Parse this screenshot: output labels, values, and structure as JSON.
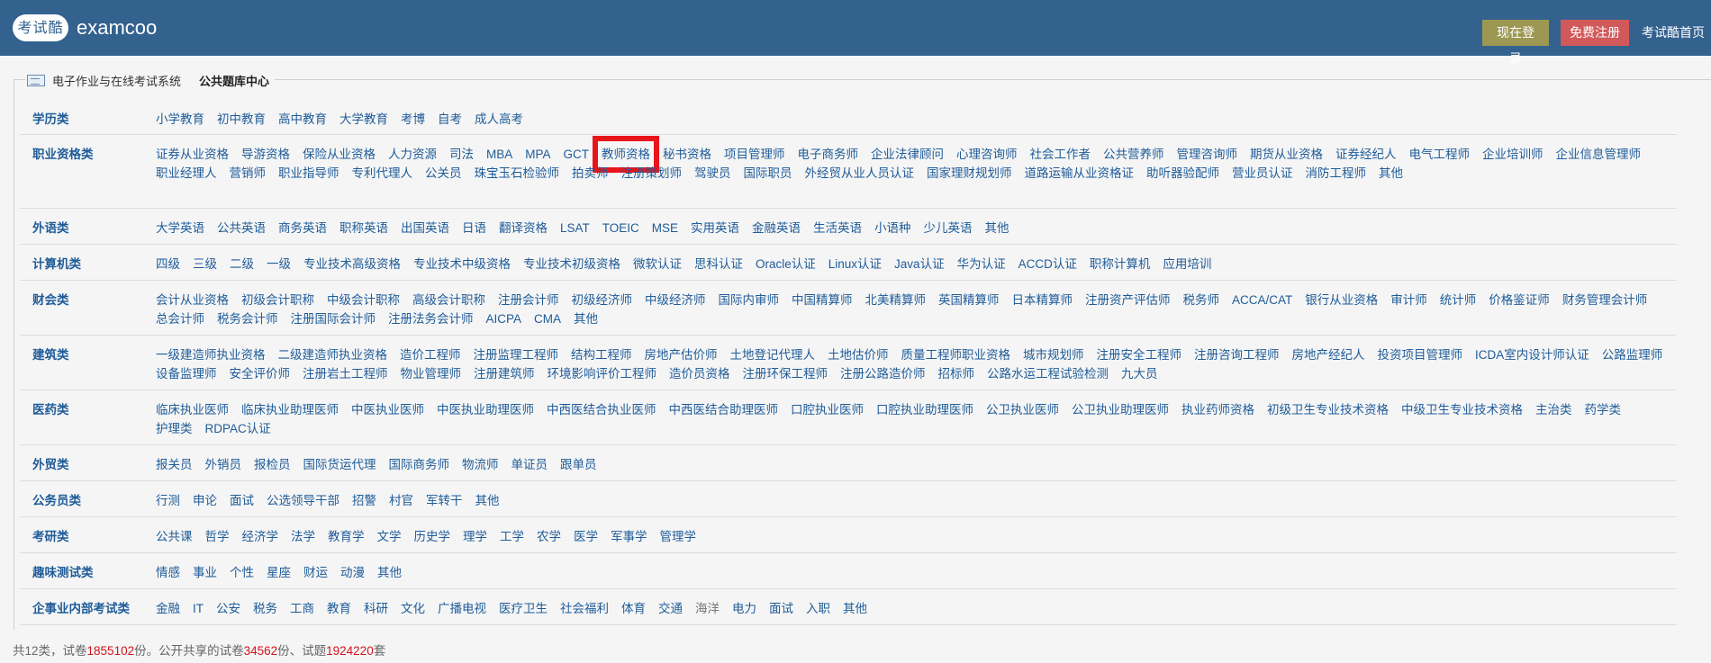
{
  "header": {
    "logo_text": "考试酷",
    "brand": "examcoo",
    "login_label": "现在登录",
    "register_label": "免费注册",
    "home_label": "考试酷首页"
  },
  "legend": {
    "system": "电子作业与在线考试系统",
    "center": "公共题库中心"
  },
  "categories": [
    {
      "name": "学历类",
      "items": [
        "小学教育",
        "初中教育",
        "高中教育",
        "大学教育",
        "考博",
        "自考",
        "成人高考"
      ]
    },
    {
      "name": "职业资格类",
      "items": [
        "证券从业资格",
        "导游资格",
        "保险从业资格",
        "人力资源",
        "司法",
        "MBA",
        "MPA",
        "GCT",
        "教师资格",
        "秘书资格",
        "项目管理师",
        "电子商务师",
        "企业法律顾问",
        "心理咨询师",
        "社会工作者",
        "公共营养师",
        "管理咨询师",
        "期货从业资格",
        "证券经纪人",
        "电气工程师",
        "企业培训师",
        "企业信息管理师",
        "职业经理人",
        "营销师",
        "职业指导师",
        "专利代理人",
        "公关员",
        "珠宝玉石检验师",
        "拍卖师",
        "注册策划师",
        "驾驶员",
        "国际职员",
        "外经贸从业人员认证",
        "国家理财规划师",
        "道路运输从业资格证",
        "助听器验配师",
        "营业员认证",
        "消防工程师",
        "其他"
      ]
    },
    {
      "name": "外语类",
      "items": [
        "大学英语",
        "公共英语",
        "商务英语",
        "职称英语",
        "出国英语",
        "日语",
        "翻译资格",
        "LSAT",
        "TOEIC",
        "MSE",
        "实用英语",
        "金融英语",
        "生活英语",
        "小语种",
        "少儿英语",
        "其他"
      ]
    },
    {
      "name": "计算机类",
      "items": [
        "四级",
        "三级",
        "二级",
        "一级",
        "专业技术高级资格",
        "专业技术中级资格",
        "专业技术初级资格",
        "微软认证",
        "思科认证",
        "Oracle认证",
        "Linux认证",
        "Java认证",
        "华为认证",
        "ACCD认证",
        "职称计算机",
        "应用培训"
      ]
    },
    {
      "name": "财会类",
      "items": [
        "会计从业资格",
        "初级会计职称",
        "中级会计职称",
        "高级会计职称",
        "注册会计师",
        "初级经济师",
        "中级经济师",
        "国际内审师",
        "中国精算师",
        "北美精算师",
        "英国精算师",
        "日本精算师",
        "注册资产评估师",
        "税务师",
        "ACCA/CAT",
        "银行从业资格",
        "审计师",
        "统计师",
        "价格鉴证师",
        "财务管理会计师",
        "总会计师",
        "税务会计师",
        "注册国际会计师",
        "注册法务会计师",
        "AICPA",
        "CMA",
        "其他"
      ]
    },
    {
      "name": "建筑类",
      "items": [
        "一级建造师执业资格",
        "二级建造师执业资格",
        "造价工程师",
        "注册监理工程师",
        "结构工程师",
        "房地产估价师",
        "土地登记代理人",
        "土地估价师",
        "质量工程师职业资格",
        "城市规划师",
        "注册安全工程师",
        "注册咨询工程师",
        "房地产经纪人",
        "投资项目管理师",
        "ICDA室内设计师认证",
        "公路监理师",
        "设备监理师",
        "安全评价师",
        "注册岩土工程师",
        "物业管理师",
        "注册建筑师",
        "环境影响评价工程师",
        "造价员资格",
        "注册环保工程师",
        "注册公路造价师",
        "招标师",
        "公路水运工程试验检测",
        "九大员"
      ]
    },
    {
      "name": "医药类",
      "items": [
        "临床执业医师",
        "临床执业助理医师",
        "中医执业医师",
        "中医执业助理医师",
        "中西医结合执业医师",
        "中西医结合助理医师",
        "口腔执业医师",
        "口腔执业助理医师",
        "公卫执业医师",
        "公卫执业助理医师",
        "执业药师资格",
        "初级卫生专业技术资格",
        "中级卫生专业技术资格",
        "主治类",
        "药学类",
        "护理类",
        "RDPAC认证"
      ]
    },
    {
      "name": "外贸类",
      "items": [
        "报关员",
        "外销员",
        "报检员",
        "国际货运代理",
        "国际商务师",
        "物流师",
        "单证员",
        "跟单员"
      ]
    },
    {
      "name": "公务员类",
      "items": [
        "行测",
        "申论",
        "面试",
        "公选领导干部",
        "招警",
        "村官",
        "军转干",
        "其他"
      ]
    },
    {
      "name": "考研类",
      "items": [
        "公共课",
        "哲学",
        "经济学",
        "法学",
        "教育学",
        "文学",
        "历史学",
        "理学",
        "工学",
        "农学",
        "医学",
        "军事学",
        "管理学"
      ]
    },
    {
      "name": "趣味测试类",
      "items": [
        "情感",
        "事业",
        "个性",
        "星座",
        "财运",
        "动漫",
        "其他"
      ]
    },
    {
      "name": "企事业内部考试类",
      "items": [
        "金融",
        "IT",
        "公安",
        "税务",
        "工商",
        "教育",
        "科研",
        "文化",
        "广播电视",
        "医疗卫生",
        "社会福利",
        "体育",
        "交通",
        "海洋",
        "电力",
        "面试",
        "入职",
        "其他"
      ]
    }
  ],
  "highlighted_item": "教师资格",
  "gray_item": "海洋",
  "footer": {
    "prefix": "共12类，试卷",
    "papers": "1855102",
    "mid": "份。公开共享的试卷",
    "shared": "34562",
    "mid2": "份、试题",
    "questions": "1924220",
    "suffix": "套"
  }
}
